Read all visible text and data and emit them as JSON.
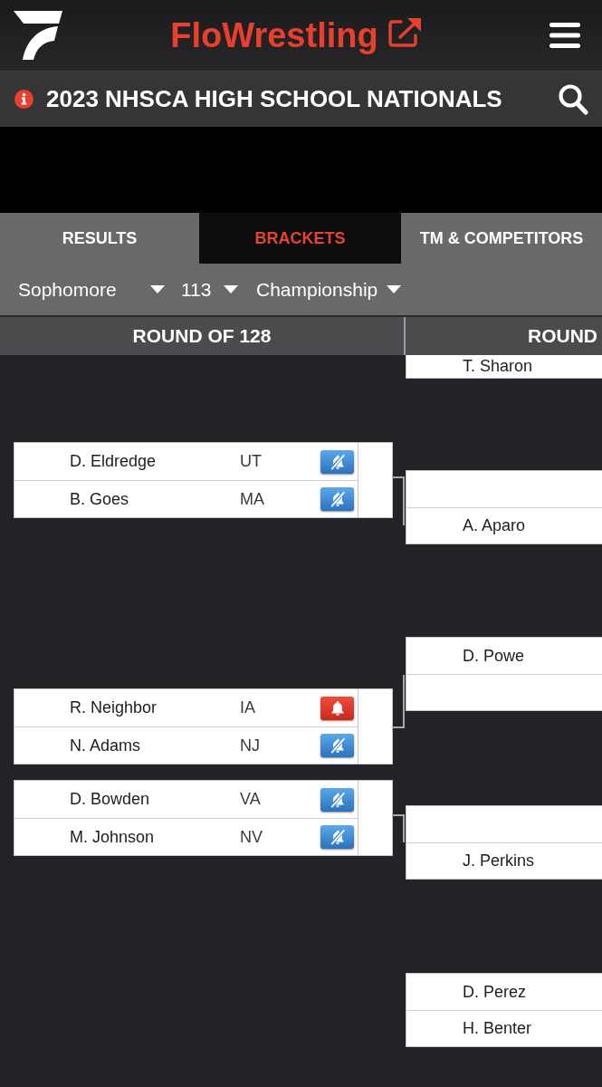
{
  "header": {
    "brand": "FloWrestling"
  },
  "event": {
    "title": "2023 NHSCA HIGH SCHOOL NATIONALS"
  },
  "tabs": [
    {
      "label": "RESULTS",
      "selected": false
    },
    {
      "label": "BRACKETS",
      "selected": true
    },
    {
      "label": "TM & COMPETITORS",
      "selected": false
    }
  ],
  "filters": [
    {
      "value": "Sophomore"
    },
    {
      "value": "113"
    },
    {
      "value": "Championship"
    }
  ],
  "rounds": [
    {
      "title": "ROUND OF 128",
      "matches": [
        {
          "top": {
            "name": "D. Eldredge",
            "state": "UT",
            "alerts_on": false
          },
          "bottom": {
            "name": "B. Goes",
            "state": "MA",
            "alerts_on": false
          }
        },
        {
          "top": {
            "name": "R. Neighbor",
            "state": "IA",
            "alerts_on": true
          },
          "bottom": {
            "name": "N. Adams",
            "state": "NJ",
            "alerts_on": false
          }
        },
        {
          "top": {
            "name": "D. Bowden",
            "state": "VA",
            "alerts_on": false
          },
          "bottom": {
            "name": "M. Johnson",
            "state": "NV",
            "alerts_on": false
          }
        }
      ]
    },
    {
      "title": "ROUND",
      "matches": [
        {
          "bottom": {
            "name": "T. Sharon"
          }
        },
        {
          "bottom": {
            "name": "A. Aparo"
          }
        },
        {
          "top": {
            "name": "D. Powe"
          }
        },
        {
          "bottom": {
            "name": "J. Perkins"
          }
        },
        {
          "top": {
            "name": "D. Perez"
          },
          "bottom": {
            "name": "H. Benter"
          }
        }
      ]
    }
  ]
}
